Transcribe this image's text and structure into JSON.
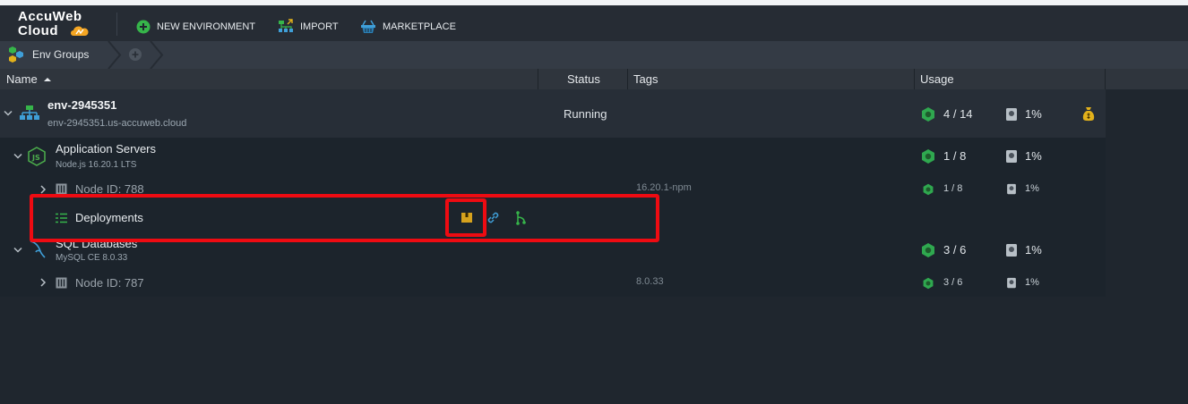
{
  "logo": {
    "line1": "AccuWeb",
    "line2": "Cloud"
  },
  "toolbar": {
    "new_environment": "NEW ENVIRONMENT",
    "import": "IMPORT",
    "marketplace": "MARKETPLACE"
  },
  "breadcrumb": {
    "env_groups": "Env Groups"
  },
  "table": {
    "headers": {
      "name": "Name",
      "status": "Status",
      "tags": "Tags",
      "usage": "Usage"
    }
  },
  "environment": {
    "name": "env-2945351",
    "domain": "env-2945351.us-accuweb.cloud",
    "status": "Running",
    "cloudlets": "4 / 14",
    "disk": "1%"
  },
  "app_servers": {
    "title": "Application Servers",
    "version": "Node.js 16.20.1 LTS",
    "cloudlets": "1 / 8",
    "disk": "1%",
    "node": {
      "label": "Node ID: 788",
      "tag": "16.20.1-npm",
      "cloudlets": "1 / 8",
      "disk": "1%"
    },
    "deployments": {
      "label": "Deployments"
    }
  },
  "sql_databases": {
    "title": "SQL Databases",
    "version": "MySQL CE 8.0.33",
    "cloudlets": "3 / 6",
    "disk": "1%",
    "node": {
      "label": "Node ID: 787",
      "tag": "8.0.33",
      "cloudlets": "3 / 6",
      "disk": "1%"
    }
  },
  "colors": {
    "accent_green": "#36b54a",
    "cloudlet_green": "#2fa84f",
    "highlight_red": "#ee0b12",
    "deploy_yellow": "#d6a21d",
    "link_blue": "#3f9fd8",
    "billing_gold": "#e2b11b"
  },
  "icons": {
    "new_environment": "plus-circle-icon",
    "import": "import-icon",
    "marketplace": "basket-icon",
    "env_groups": "hexagons-icon",
    "environment": "topology-icon",
    "app_server": "nodejs-icon",
    "database": "mysql-dolphin-icon",
    "node": "server-node-icon",
    "deployments": "list-icon",
    "deploy_archive": "archive-icon",
    "link": "link-icon",
    "git": "git-branch-icon",
    "cloudlet": "cloudlet-hexagon-icon",
    "disk": "disk-icon",
    "billing": "money-bag-icon"
  }
}
